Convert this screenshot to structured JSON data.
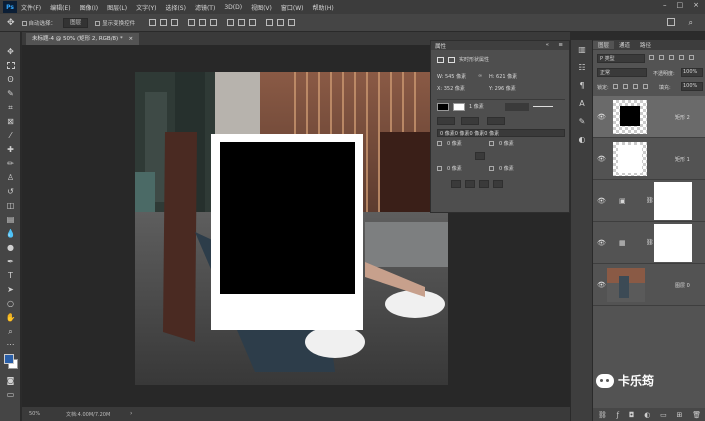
{
  "app": {
    "logo": "Ps"
  },
  "menu": [
    "文件(F)",
    "编辑(E)",
    "图像(I)",
    "图层(L)",
    "文字(Y)",
    "选择(S)",
    "滤镜(T)",
    "3D(D)",
    "视图(V)",
    "窗口(W)",
    "帮助(H)"
  ],
  "window_controls": {
    "minimize": "–",
    "maximize": "□",
    "close": "×"
  },
  "options": {
    "auto_select_label": "自动选择：",
    "auto_select_value": "图层",
    "transform_label": "显示变换控件"
  },
  "document": {
    "tab_label": "未标题-4 @ 50% (矩形 2, RGB/8) *",
    "close": "×"
  },
  "status": {
    "zoom": "50%",
    "doc_size": "文档:4.00M/7.20M"
  },
  "properties": {
    "title": "属性",
    "section": "实时形状属性",
    "w_label": "W:",
    "w_value": "545 像素",
    "h_label": "H:",
    "h_value": "621 像素",
    "x_label": "X:",
    "x_value": "352 像素",
    "y_label": "Y:",
    "y_value": "296 像素",
    "stroke_width": "1 像素",
    "corner_label": "0 像素0 像素0 像素0 像素",
    "corners": [
      "0 像素",
      "0 像素",
      "0 像素",
      "0 像素"
    ]
  },
  "layers_panel": {
    "tabs": [
      "图层",
      "通道",
      "路径"
    ],
    "kind_filter": "P 类型",
    "blend_mode": "正常",
    "opacity_label": "不透明度:",
    "opacity_value": "100%",
    "lock_label": "锁定:",
    "fill_label": "填充:",
    "fill_value": "100%",
    "layers": [
      {
        "name": "矩形 2"
      },
      {
        "name": "矩形 1"
      },
      {
        "name": ""
      },
      {
        "name": ""
      },
      {
        "name": "图层 0"
      }
    ]
  },
  "watermark": {
    "text": "卡乐筠"
  },
  "colors": {
    "accent": "#31a8ff",
    "selected_row": "#6a6a6a"
  }
}
